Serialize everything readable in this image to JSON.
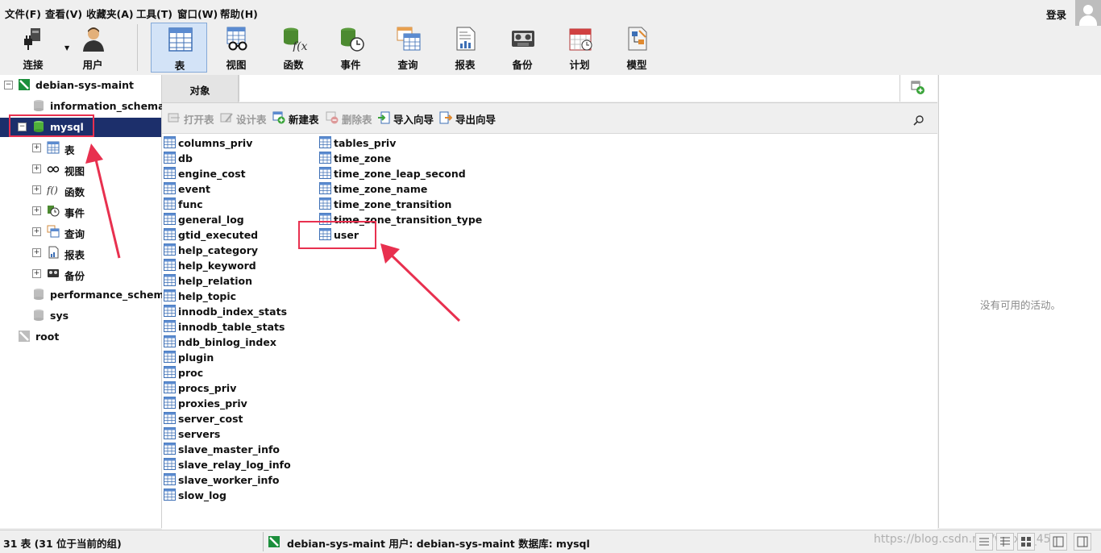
{
  "menu": [
    "文件(F)",
    "查看(V)",
    "收藏夹(A)",
    "工具(T)",
    "窗口(W)",
    "帮助(H)"
  ],
  "login_label": "登录",
  "toolbar": {
    "connect": "连接",
    "user": "用户",
    "table": "表",
    "view": "视图",
    "function": "函数",
    "event": "事件",
    "query": "查询",
    "report": "报表",
    "backup": "备份",
    "schedule": "计划",
    "model": "模型"
  },
  "tree": {
    "connection": "debian-sys-maint",
    "information_schema": "information_schema",
    "mysql": "mysql",
    "children": [
      "表",
      "视图",
      "函数",
      "事件",
      "查询",
      "报表",
      "备份"
    ],
    "performance_schema": "performance_schema",
    "sys": "sys",
    "root": "root"
  },
  "tab_label": "对象",
  "objbar": {
    "open": "打开表",
    "design": "设计表",
    "new": "新建表",
    "delete": "删除表",
    "import": "导入向导",
    "export": "导出向导"
  },
  "tables_col1": [
    "columns_priv",
    "db",
    "engine_cost",
    "event",
    "func",
    "general_log",
    "gtid_executed",
    "help_category",
    "help_keyword",
    "help_relation",
    "help_topic",
    "innodb_index_stats",
    "innodb_table_stats",
    "ndb_binlog_index",
    "plugin",
    "proc",
    "procs_priv",
    "proxies_priv",
    "server_cost",
    "servers",
    "slave_master_info",
    "slave_relay_log_info",
    "slave_worker_info",
    "slow_log"
  ],
  "tables_col2": [
    "tables_priv",
    "time_zone",
    "time_zone_leap_second",
    "time_zone_name",
    "time_zone_transition",
    "time_zone_transition_type",
    "user"
  ],
  "no_activity": "没有可用的活动。",
  "status": {
    "count": "31 表 (31 位于当前的组)",
    "connection": "debian-sys-maint   用户: debian-sys-maint   数据库: mysql",
    "watermark": "https://blog.csdn.net/weixin_45..."
  },
  "colors": {
    "selection": "#1c2f6b",
    "annotation": "#e8304f",
    "toolbar_active": "#d3e3f7"
  }
}
